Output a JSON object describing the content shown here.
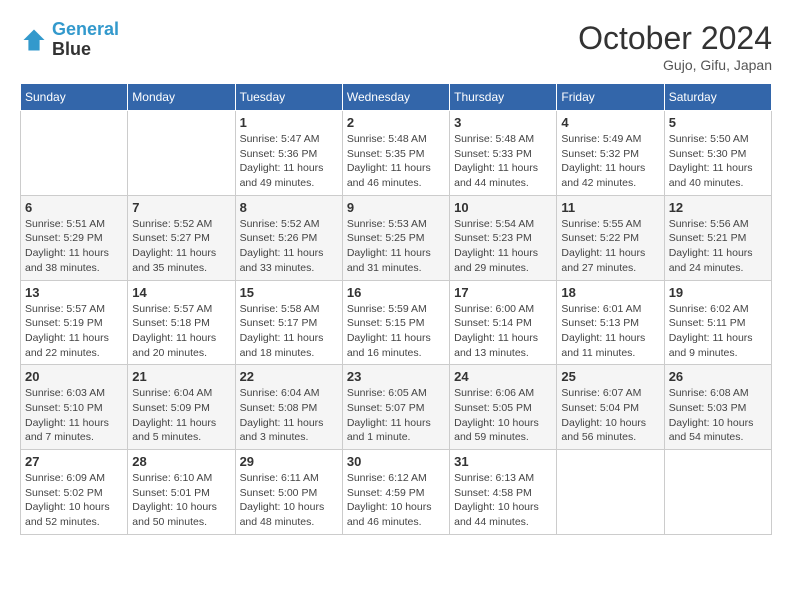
{
  "header": {
    "logo_line1": "General",
    "logo_line2": "Blue",
    "month_title": "October 2024",
    "subtitle": "Gujo, Gifu, Japan"
  },
  "weekdays": [
    "Sunday",
    "Monday",
    "Tuesday",
    "Wednesday",
    "Thursday",
    "Friday",
    "Saturday"
  ],
  "weeks": [
    [
      {
        "day": "",
        "info": ""
      },
      {
        "day": "",
        "info": ""
      },
      {
        "day": "1",
        "info": "Sunrise: 5:47 AM\nSunset: 5:36 PM\nDaylight: 11 hours and 49 minutes."
      },
      {
        "day": "2",
        "info": "Sunrise: 5:48 AM\nSunset: 5:35 PM\nDaylight: 11 hours and 46 minutes."
      },
      {
        "day": "3",
        "info": "Sunrise: 5:48 AM\nSunset: 5:33 PM\nDaylight: 11 hours and 44 minutes."
      },
      {
        "day": "4",
        "info": "Sunrise: 5:49 AM\nSunset: 5:32 PM\nDaylight: 11 hours and 42 minutes."
      },
      {
        "day": "5",
        "info": "Sunrise: 5:50 AM\nSunset: 5:30 PM\nDaylight: 11 hours and 40 minutes."
      }
    ],
    [
      {
        "day": "6",
        "info": "Sunrise: 5:51 AM\nSunset: 5:29 PM\nDaylight: 11 hours and 38 minutes."
      },
      {
        "day": "7",
        "info": "Sunrise: 5:52 AM\nSunset: 5:27 PM\nDaylight: 11 hours and 35 minutes."
      },
      {
        "day": "8",
        "info": "Sunrise: 5:52 AM\nSunset: 5:26 PM\nDaylight: 11 hours and 33 minutes."
      },
      {
        "day": "9",
        "info": "Sunrise: 5:53 AM\nSunset: 5:25 PM\nDaylight: 11 hours and 31 minutes."
      },
      {
        "day": "10",
        "info": "Sunrise: 5:54 AM\nSunset: 5:23 PM\nDaylight: 11 hours and 29 minutes."
      },
      {
        "day": "11",
        "info": "Sunrise: 5:55 AM\nSunset: 5:22 PM\nDaylight: 11 hours and 27 minutes."
      },
      {
        "day": "12",
        "info": "Sunrise: 5:56 AM\nSunset: 5:21 PM\nDaylight: 11 hours and 24 minutes."
      }
    ],
    [
      {
        "day": "13",
        "info": "Sunrise: 5:57 AM\nSunset: 5:19 PM\nDaylight: 11 hours and 22 minutes."
      },
      {
        "day": "14",
        "info": "Sunrise: 5:57 AM\nSunset: 5:18 PM\nDaylight: 11 hours and 20 minutes."
      },
      {
        "day": "15",
        "info": "Sunrise: 5:58 AM\nSunset: 5:17 PM\nDaylight: 11 hours and 18 minutes."
      },
      {
        "day": "16",
        "info": "Sunrise: 5:59 AM\nSunset: 5:15 PM\nDaylight: 11 hours and 16 minutes."
      },
      {
        "day": "17",
        "info": "Sunrise: 6:00 AM\nSunset: 5:14 PM\nDaylight: 11 hours and 13 minutes."
      },
      {
        "day": "18",
        "info": "Sunrise: 6:01 AM\nSunset: 5:13 PM\nDaylight: 11 hours and 11 minutes."
      },
      {
        "day": "19",
        "info": "Sunrise: 6:02 AM\nSunset: 5:11 PM\nDaylight: 11 hours and 9 minutes."
      }
    ],
    [
      {
        "day": "20",
        "info": "Sunrise: 6:03 AM\nSunset: 5:10 PM\nDaylight: 11 hours and 7 minutes."
      },
      {
        "day": "21",
        "info": "Sunrise: 6:04 AM\nSunset: 5:09 PM\nDaylight: 11 hours and 5 minutes."
      },
      {
        "day": "22",
        "info": "Sunrise: 6:04 AM\nSunset: 5:08 PM\nDaylight: 11 hours and 3 minutes."
      },
      {
        "day": "23",
        "info": "Sunrise: 6:05 AM\nSunset: 5:07 PM\nDaylight: 11 hours and 1 minute."
      },
      {
        "day": "24",
        "info": "Sunrise: 6:06 AM\nSunset: 5:05 PM\nDaylight: 10 hours and 59 minutes."
      },
      {
        "day": "25",
        "info": "Sunrise: 6:07 AM\nSunset: 5:04 PM\nDaylight: 10 hours and 56 minutes."
      },
      {
        "day": "26",
        "info": "Sunrise: 6:08 AM\nSunset: 5:03 PM\nDaylight: 10 hours and 54 minutes."
      }
    ],
    [
      {
        "day": "27",
        "info": "Sunrise: 6:09 AM\nSunset: 5:02 PM\nDaylight: 10 hours and 52 minutes."
      },
      {
        "day": "28",
        "info": "Sunrise: 6:10 AM\nSunset: 5:01 PM\nDaylight: 10 hours and 50 minutes."
      },
      {
        "day": "29",
        "info": "Sunrise: 6:11 AM\nSunset: 5:00 PM\nDaylight: 10 hours and 48 minutes."
      },
      {
        "day": "30",
        "info": "Sunrise: 6:12 AM\nSunset: 4:59 PM\nDaylight: 10 hours and 46 minutes."
      },
      {
        "day": "31",
        "info": "Sunrise: 6:13 AM\nSunset: 4:58 PM\nDaylight: 10 hours and 44 minutes."
      },
      {
        "day": "",
        "info": ""
      },
      {
        "day": "",
        "info": ""
      }
    ]
  ]
}
